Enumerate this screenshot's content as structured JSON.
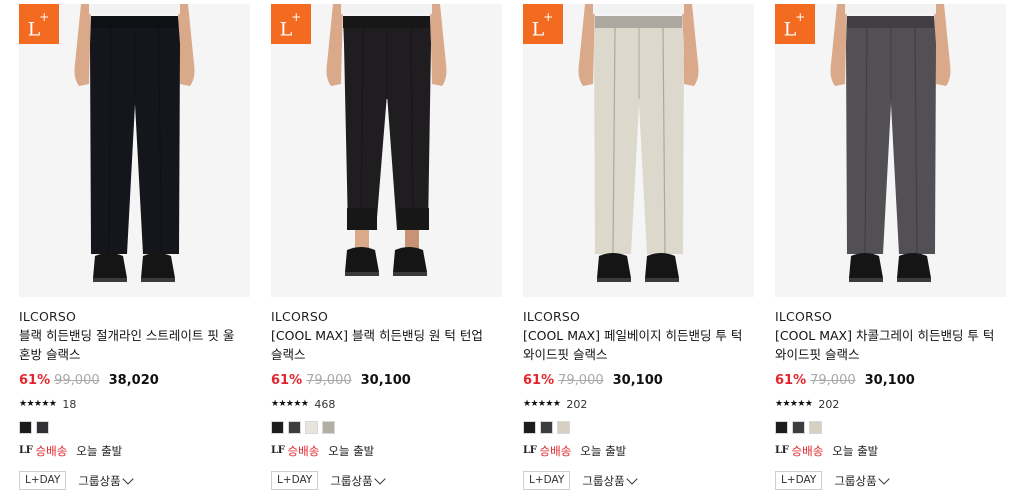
{
  "products": [
    {
      "badge": {
        "main": "L",
        "sup": "+"
      },
      "brand": "ILCORSO",
      "title": "블랙 히든밴딩 절개라인 스트레이트 핏 울 혼방 슬랙스",
      "discount": "61%",
      "original_price": "99,000",
      "sale_price": "38,020",
      "stars": "★★★★★",
      "review_count": "18",
      "pants_color": "#14161b",
      "swatches": [
        "#1c1c1c",
        "#2f3033"
      ],
      "cuffed": false,
      "ship_logo": "LF",
      "ship_label": "승배송",
      "ship_note": "오늘 출발",
      "lday_label": "L+DAY",
      "group_label": "그룹상품"
    },
    {
      "badge": {
        "main": "L",
        "sup": "+"
      },
      "brand": "ILCORSO",
      "title": "[COOL MAX] 블랙 히든밴딩 원 턱 턴업 슬랙스",
      "discount": "61%",
      "original_price": "79,000",
      "sale_price": "30,100",
      "stars": "★★★★★",
      "review_count": "468",
      "pants_color": "#1f1d1f",
      "swatches": [
        "#1c1c1c",
        "#3d3d40",
        "#e7e4de",
        "#b3aea4"
      ],
      "cuffed": true,
      "ship_logo": "LF",
      "ship_label": "승배송",
      "ship_note": "오늘 출발",
      "lday_label": "L+DAY",
      "group_label": "그룹상품"
    },
    {
      "badge": {
        "main": "L",
        "sup": "+"
      },
      "brand": "ILCORSO",
      "title": "[COOL MAX] 페일베이지 히든밴딩 투 턱 와이드핏 슬랙스",
      "discount": "61%",
      "original_price": "79,000",
      "sale_price": "30,100",
      "stars": "★★★★★",
      "review_count": "202",
      "pants_color": "#ddd8cc",
      "swatches": [
        "#1c1c1c",
        "#3d3d40",
        "#d6cfc2"
      ],
      "cuffed": false,
      "ship_logo": "LF",
      "ship_label": "승배송",
      "ship_note": "오늘 출발",
      "lday_label": "L+DAY",
      "group_label": "그룹상품"
    },
    {
      "badge": {
        "main": "L",
        "sup": "+"
      },
      "brand": "ILCORSO",
      "title": "[COOL MAX] 차콜그레이 히든밴딩 투 턱 와이드핏 슬랙스",
      "discount": "61%",
      "original_price": "79,000",
      "sale_price": "30,100",
      "stars": "★★★★★",
      "review_count": "202",
      "pants_color": "#525054",
      "swatches": [
        "#1c1c1c",
        "#3d3d40",
        "#d6cfc2"
      ],
      "cuffed": false,
      "ship_logo": "LF",
      "ship_label": "승배송",
      "ship_note": "오늘 출발",
      "lday_label": "L+DAY",
      "group_label": "그룹상품"
    }
  ]
}
